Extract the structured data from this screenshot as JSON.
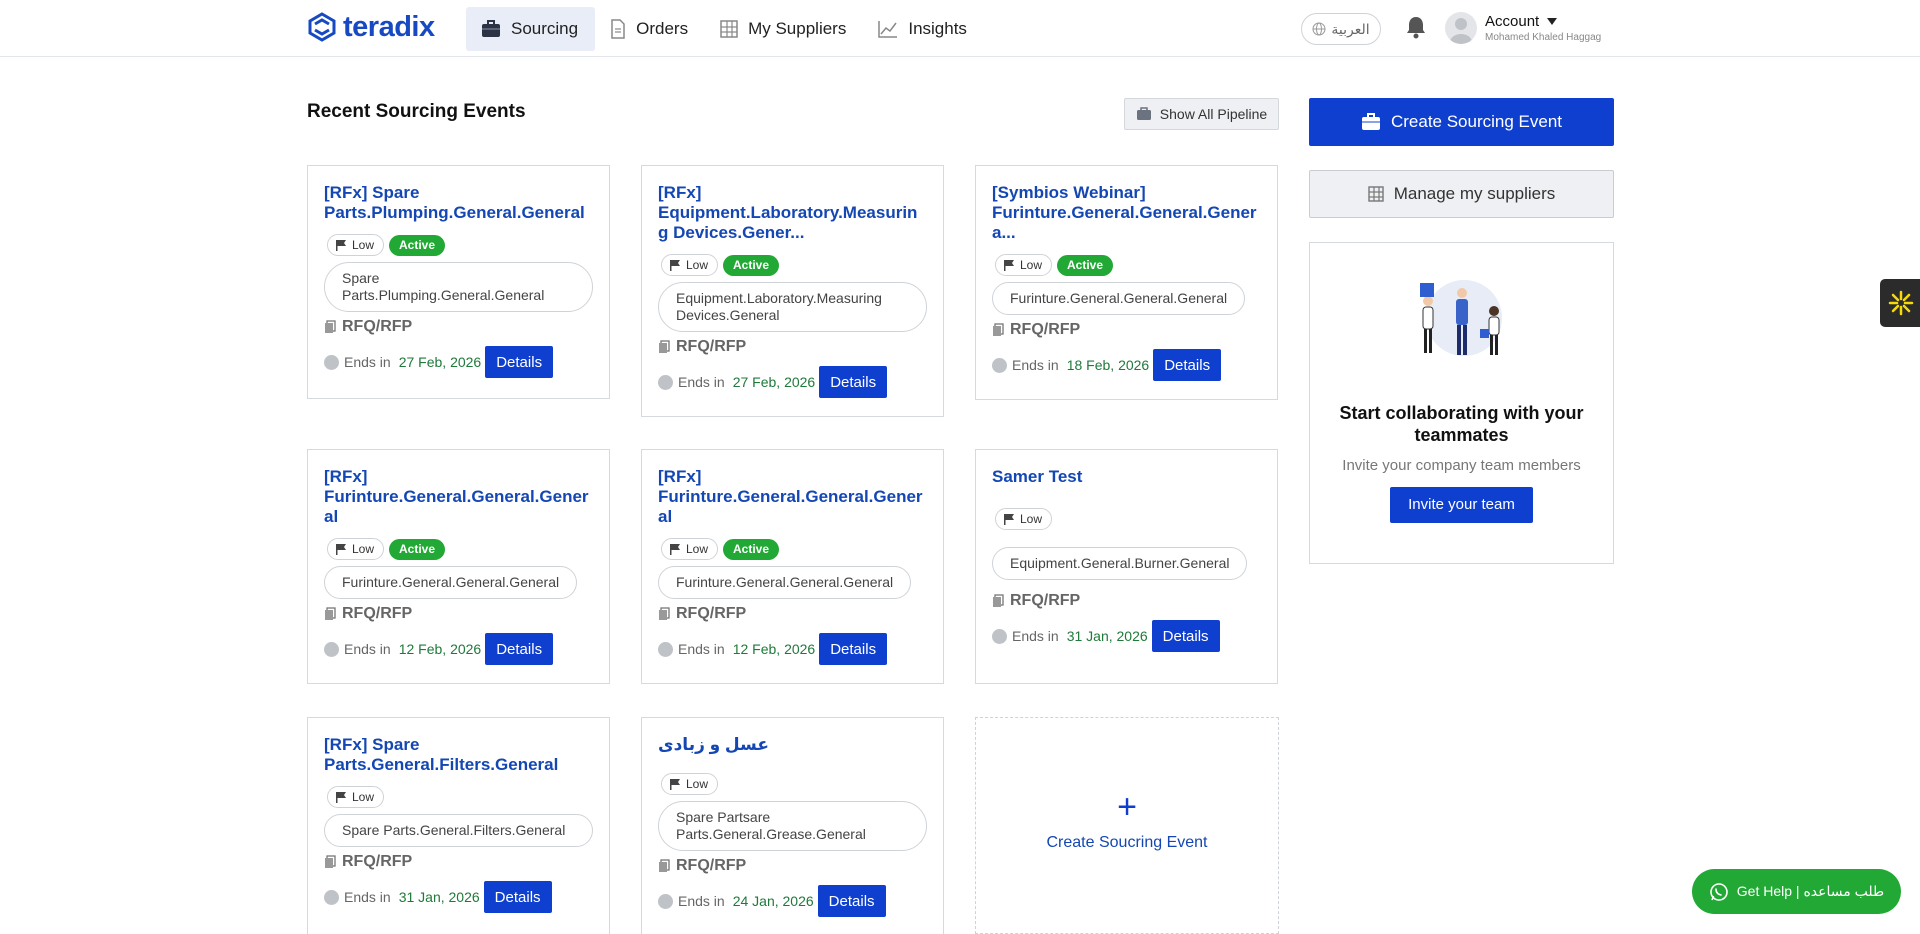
{
  "header": {
    "logo_text": "teradix",
    "nav": [
      {
        "label": "Sourcing",
        "icon": "briefcase-icon",
        "active": true
      },
      {
        "label": "Orders",
        "icon": "document-icon",
        "active": false
      },
      {
        "label": "My Suppliers",
        "icon": "grid-icon",
        "active": false
      },
      {
        "label": "Insights",
        "icon": "chart-icon",
        "active": false
      }
    ],
    "language_label": "العربية",
    "account_label": "Account",
    "account_name": "Mohamed Khaled Haggag"
  },
  "main": {
    "section_title": "Recent Sourcing Events",
    "show_pipeline_label": "Show All Pipeline",
    "cards": [
      {
        "title": "[RFx] Spare Parts.Plumping.General.General",
        "priority": "Low",
        "status": "Active",
        "category": "Spare Parts.Plumping.General.General",
        "type": "RFQ/RFP",
        "ends_label": "Ends in",
        "end_date": "27 Feb, 2026",
        "details_label": "Details"
      },
      {
        "title": "[RFx] Equipment.Laboratory.Measuring Devices.Gener...",
        "priority": "Low",
        "status": "Active",
        "category": "Equipment.Laboratory.Measuring Devices.General",
        "type": "RFQ/RFP",
        "ends_label": "Ends in",
        "end_date": "27 Feb, 2026",
        "details_label": "Details"
      },
      {
        "title": "[Symbios Webinar] Furinture.General.General.Genera...",
        "priority": "Low",
        "status": "Active",
        "category": "Furinture.General.General.General",
        "type": "RFQ/RFP",
        "ends_label": "Ends in",
        "end_date": "18 Feb, 2026",
        "details_label": "Details"
      },
      {
        "title": "[RFx] Furinture.General.General.General",
        "priority": "Low",
        "status": "Active",
        "category": "Furinture.General.General.General",
        "type": "RFQ/RFP",
        "ends_label": "Ends in",
        "end_date": "12 Feb, 2026",
        "details_label": "Details"
      },
      {
        "title": "[RFx] Furinture.General.General.General",
        "priority": "Low",
        "status": "Active",
        "category": "Furinture.General.General.General",
        "type": "RFQ/RFP",
        "ends_label": "Ends in",
        "end_date": "12 Feb, 2026",
        "details_label": "Details"
      },
      {
        "title": "Samer Test",
        "priority": "Low",
        "status": "",
        "category": "Equipment.General.Burner.General",
        "type": "RFQ/RFP",
        "ends_label": "Ends in",
        "end_date": "31 Jan, 2026",
        "details_label": "Details"
      },
      {
        "title": "[RFx] Spare Parts.General.Filters.General",
        "priority": "Low",
        "status": "",
        "category": "Spare Parts.General.Filters.General",
        "type": "RFQ/RFP",
        "ends_label": "Ends in",
        "end_date": "31 Jan, 2026",
        "details_label": "Details"
      },
      {
        "title": "عسل و زبادى",
        "priority": "Low",
        "status": "",
        "category": "Spare Partsare Parts.General.Grease.General",
        "type": "RFQ/RFP",
        "ends_label": "Ends in",
        "end_date": "24 Jan, 2026",
        "details_label": "Details"
      }
    ],
    "create_card_label": "Create Soucring Event",
    "create_card_icon": "plus-icon"
  },
  "sidebar": {
    "create_event_label": "Create Sourcing Event",
    "manage_suppliers_label": "Manage my suppliers",
    "collab_title": "Start collaborating with your teammates",
    "collab_subtitle": "Invite your company team members",
    "invite_label": "Invite your team"
  },
  "help": {
    "label": "Get Help | طلب مساعده",
    "icon": "whatsapp-icon"
  },
  "colors": {
    "primary": "#0e3fcf",
    "link": "#1447b3",
    "active_badge": "#22a834",
    "date": "#1f7a3a"
  }
}
